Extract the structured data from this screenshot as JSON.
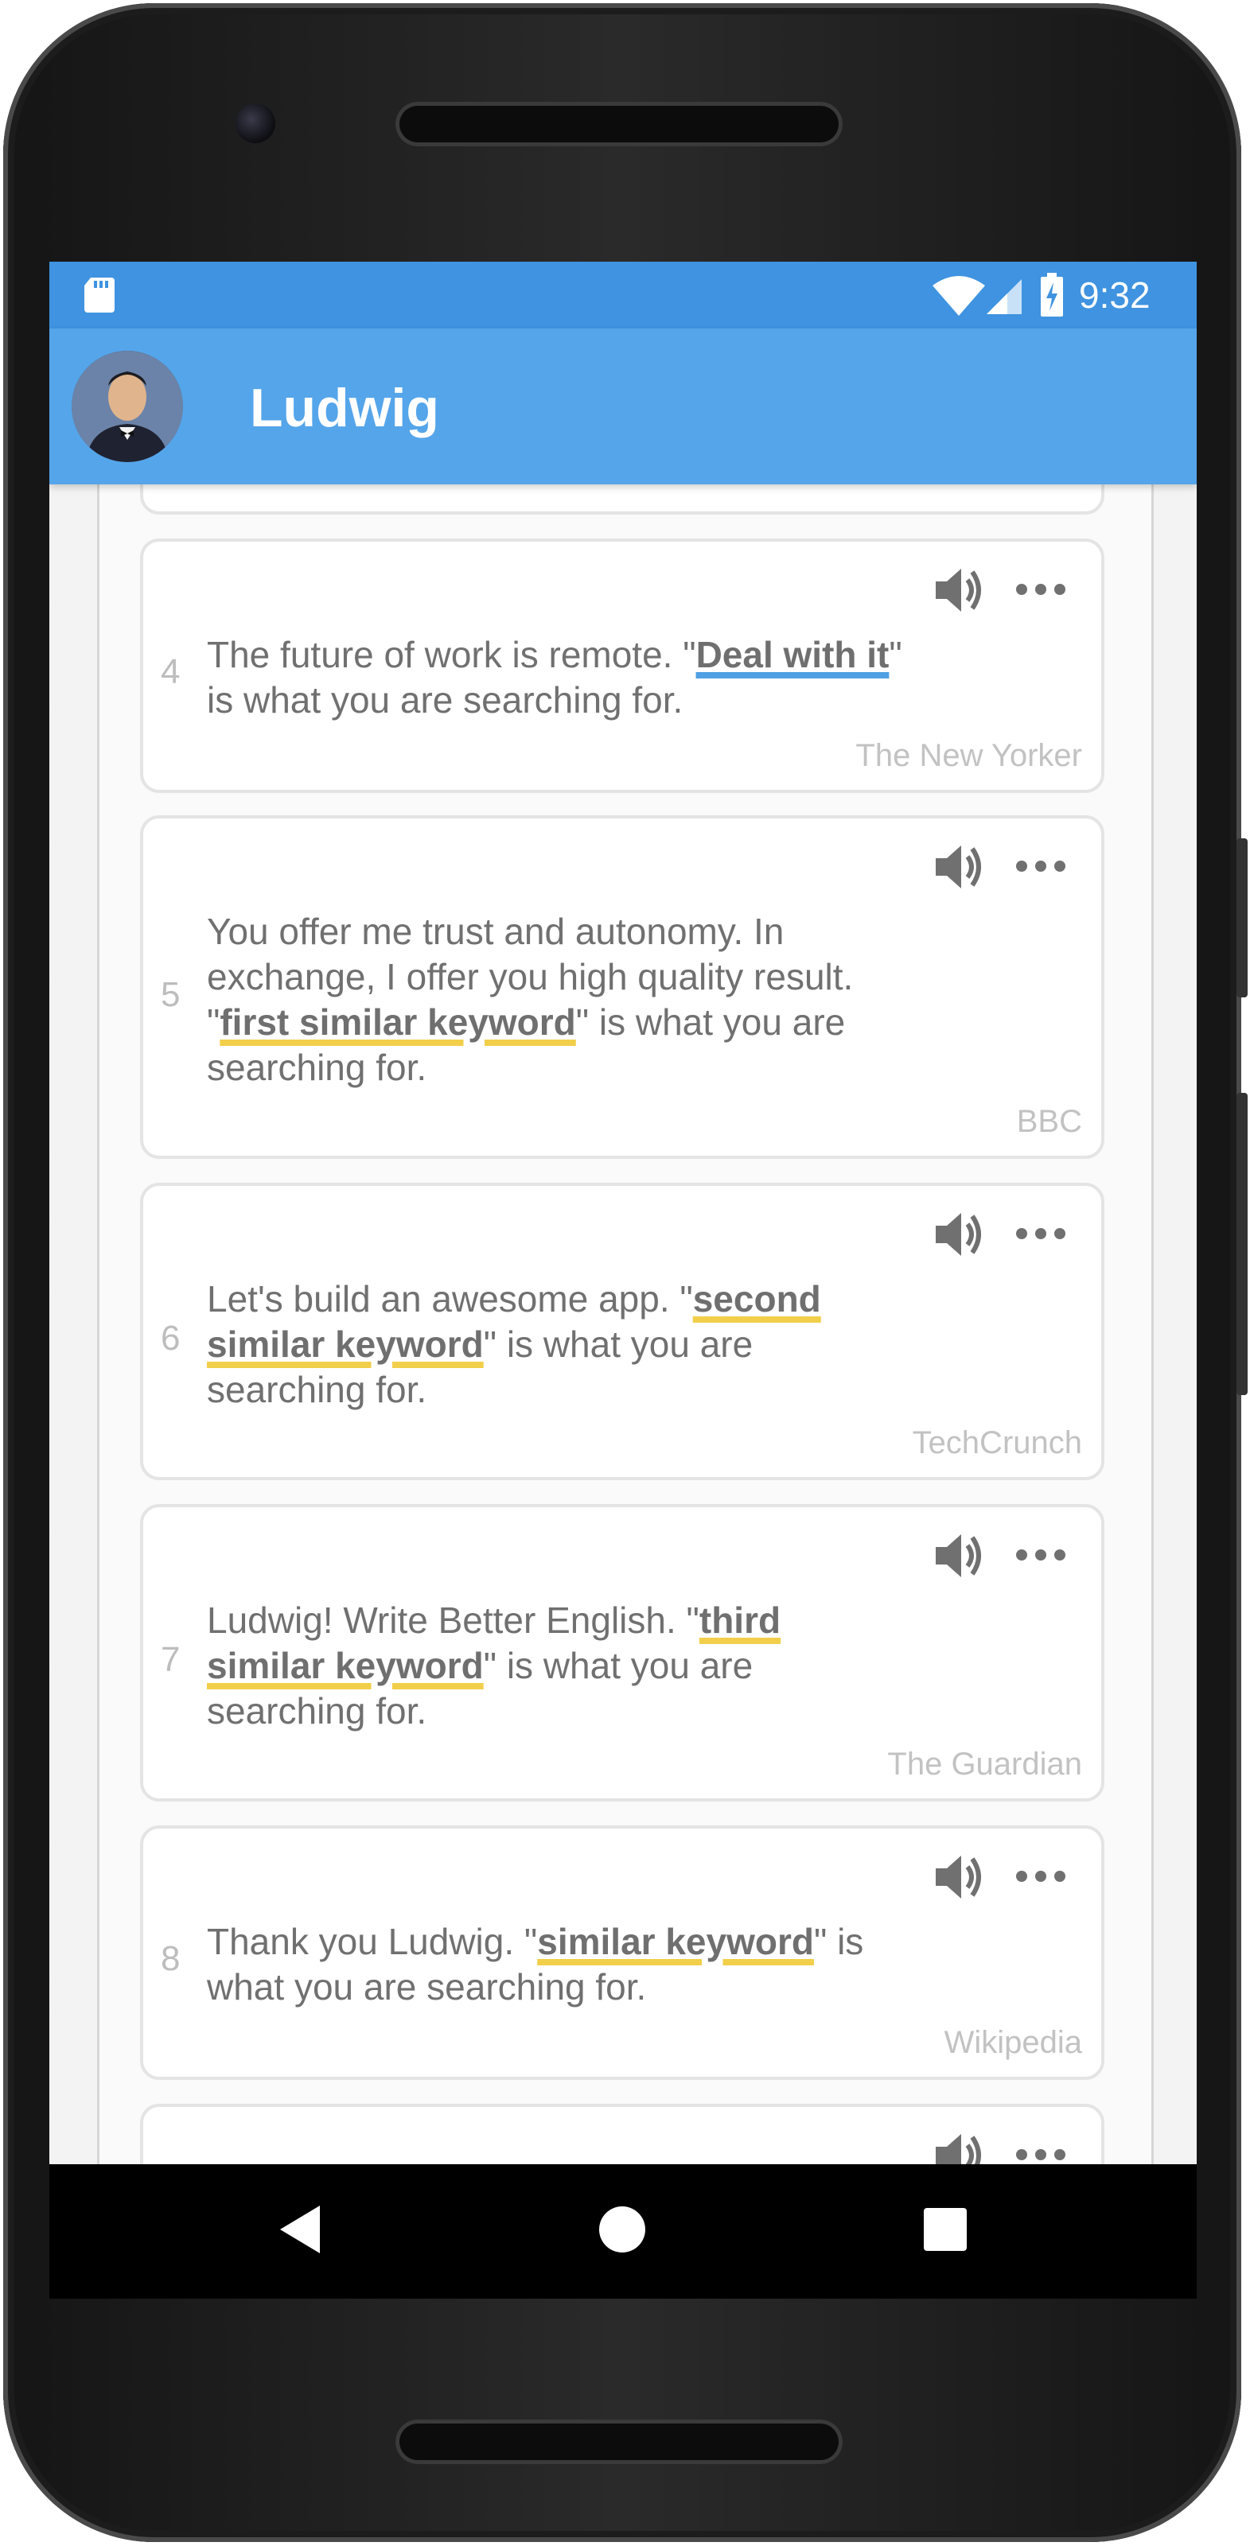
{
  "status_bar": {
    "time": "9:32"
  },
  "app_bar": {
    "title": "Ludwig"
  },
  "results": [
    {
      "number": "4",
      "before": "The future of work is remote. \"",
      "keyword": "Deal with it",
      "after": "\" is what you are searching for.",
      "source": "The New Yorker",
      "highlight": "blue"
    },
    {
      "number": "5",
      "before": "You offer me trust and autonomy. In exchange, I offer you high quality result. \"",
      "keyword": "first similar keyword",
      "after": "\" is what you are searching for.",
      "source": "BBC",
      "highlight": "yellow"
    },
    {
      "number": "6",
      "before": "Let's build an awesome app. \"",
      "keyword": "second similar keyword",
      "after": "\" is what you are searching for.",
      "source": "TechCrunch",
      "highlight": "yellow"
    },
    {
      "number": "7",
      "before": "Ludwig! Write Better English. \"",
      "keyword": "third similar keyword",
      "after": "\" is what you are searching for.",
      "source": "The Guardian",
      "highlight": "yellow"
    },
    {
      "number": "8",
      "before": "Thank you Ludwig. \"",
      "keyword": "similar keyword",
      "after": "\" is what you are searching for.",
      "source": "Wikipedia",
      "highlight": "yellow"
    }
  ],
  "icons": {
    "status": [
      "sd-card-icon",
      "wifi-icon",
      "cell-signal-icon",
      "battery-charging-icon"
    ],
    "card_actions": [
      "volume-icon",
      "more-icon"
    ],
    "nav": [
      "back-icon",
      "home-icon",
      "recents-icon"
    ]
  },
  "colors": {
    "status_bar": "#3f93e0",
    "app_bar": "#55a5ea",
    "highlight_blue": "#4e9fe3",
    "highlight_yellow": "#f2cf4a"
  }
}
